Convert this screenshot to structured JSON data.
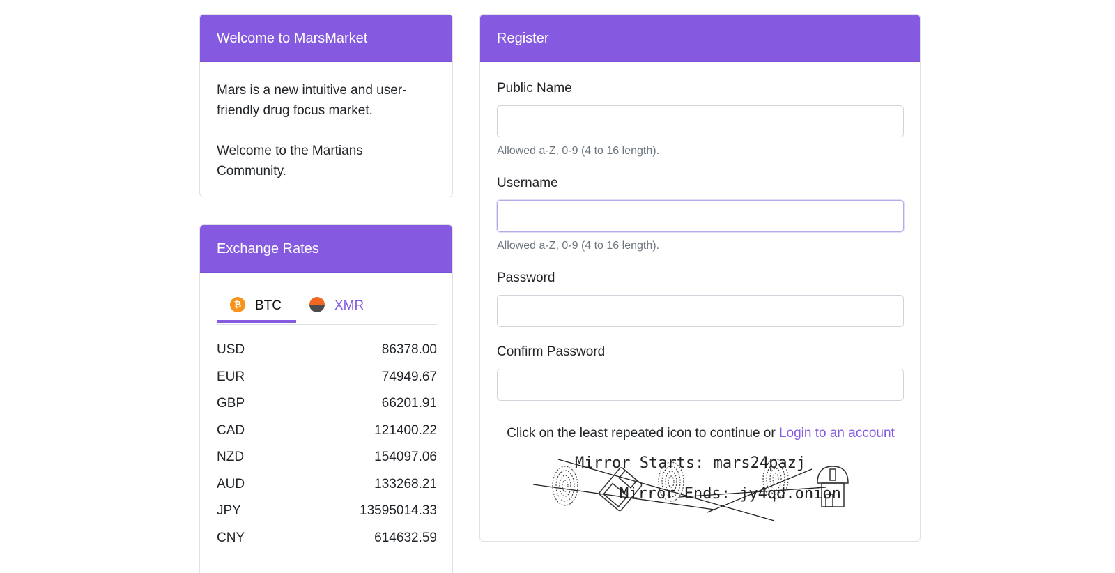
{
  "welcome": {
    "title": "Welcome to MarsMarket",
    "paragraph1": "Mars is a new intuitive and user-friendly drug focus market.",
    "paragraph2": "Welcome to the Martians Community."
  },
  "exchange": {
    "title": "Exchange Rates",
    "tabs": [
      {
        "label": "BTC",
        "icon": "bitcoin-icon",
        "active": true
      },
      {
        "label": "XMR",
        "icon": "monero-icon",
        "active": false
      }
    ],
    "rates": [
      {
        "currency": "USD",
        "value": "86378.00"
      },
      {
        "currency": "EUR",
        "value": "74949.67"
      },
      {
        "currency": "GBP",
        "value": "66201.91"
      },
      {
        "currency": "CAD",
        "value": "121400.22"
      },
      {
        "currency": "NZD",
        "value": "154097.06"
      },
      {
        "currency": "AUD",
        "value": "133268.21"
      },
      {
        "currency": "JPY",
        "value": "13595014.33"
      },
      {
        "currency": "CNY",
        "value": "614632.59"
      }
    ]
  },
  "register": {
    "title": "Register",
    "public_name_label": "Public Name",
    "public_name_hint": "Allowed a-Z, 0-9 (4 to 16 length).",
    "username_label": "Username",
    "username_hint": "Allowed a-Z, 0-9 (4 to 16 length).",
    "password_label": "Password",
    "confirm_password_label": "Confirm Password",
    "captcha_instruction": "Click on the least repeated icon to continue or",
    "login_link": "Login to an account",
    "captcha_mirror_start": "Mirror Starts: mars24pazj",
    "captcha_mirror_end": "Mirror Ends: jy4qd.onion"
  },
  "colors": {
    "accent": "#855ae0",
    "bitcoin": "#f7931a",
    "monero": "#f26822"
  }
}
